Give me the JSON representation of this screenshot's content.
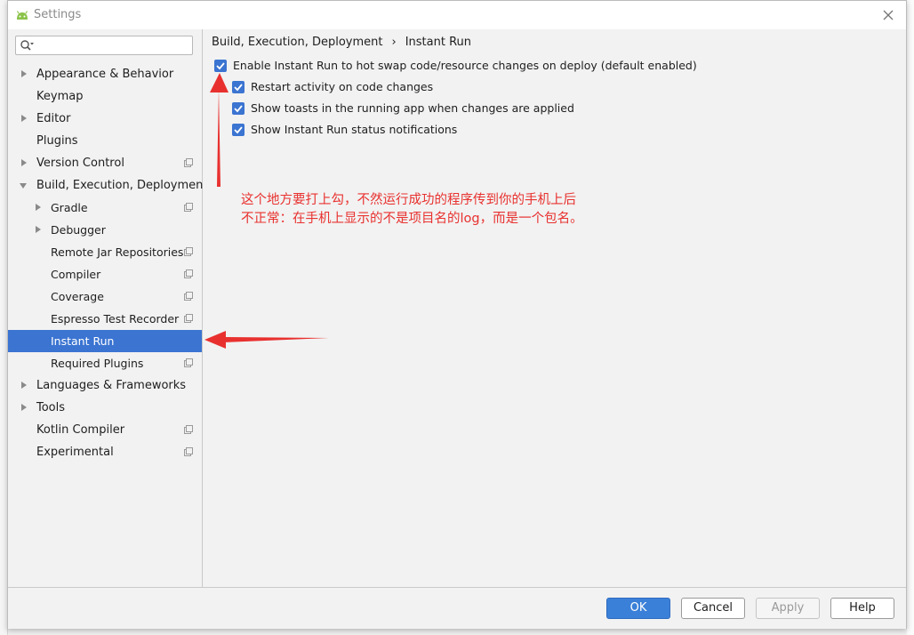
{
  "window": {
    "title": "Settings"
  },
  "search": {
    "placeholder": ""
  },
  "sidebar": {
    "items": [
      {
        "label": "Appearance & Behavior",
        "level": 0,
        "arrow": "collapsed",
        "proj": false
      },
      {
        "label": "Keymap",
        "level": 0,
        "arrow": "none",
        "proj": false
      },
      {
        "label": "Editor",
        "level": 0,
        "arrow": "collapsed",
        "proj": false
      },
      {
        "label": "Plugins",
        "level": 0,
        "arrow": "none",
        "proj": false
      },
      {
        "label": "Version Control",
        "level": 0,
        "arrow": "collapsed",
        "proj": true
      },
      {
        "label": "Build, Execution, Deployment",
        "level": 0,
        "arrow": "expanded",
        "proj": false
      },
      {
        "label": "Gradle",
        "level": 1,
        "arrow": "collapsed",
        "proj": true
      },
      {
        "label": "Debugger",
        "level": 1,
        "arrow": "collapsed",
        "proj": false
      },
      {
        "label": "Remote Jar Repositories",
        "level": 1,
        "arrow": "none",
        "proj": true
      },
      {
        "label": "Compiler",
        "level": 1,
        "arrow": "none",
        "proj": true
      },
      {
        "label": "Coverage",
        "level": 1,
        "arrow": "none",
        "proj": true
      },
      {
        "label": "Espresso Test Recorder",
        "level": 1,
        "arrow": "none",
        "proj": true
      },
      {
        "label": "Instant Run",
        "level": 1,
        "arrow": "none",
        "proj": false,
        "selected": true
      },
      {
        "label": "Required Plugins",
        "level": 1,
        "arrow": "none",
        "proj": true
      },
      {
        "label": "Languages & Frameworks",
        "level": 0,
        "arrow": "collapsed",
        "proj": false
      },
      {
        "label": "Tools",
        "level": 0,
        "arrow": "collapsed",
        "proj": false
      },
      {
        "label": "Kotlin Compiler",
        "level": 0,
        "arrow": "none",
        "proj": true
      },
      {
        "label": "Experimental",
        "level": 0,
        "arrow": "none",
        "proj": true
      }
    ]
  },
  "breadcrumb": {
    "parent": "Build, Execution, Deployment",
    "separator": "›",
    "current": "Instant Run"
  },
  "options": {
    "enable": {
      "label": "Enable Instant Run to hot swap code/resource changes on deploy (default enabled)",
      "checked": true
    },
    "restart": {
      "label": "Restart activity on code changes",
      "checked": true
    },
    "toasts": {
      "label": "Show toasts in the running app when changes are applied",
      "checked": true
    },
    "notifications": {
      "label": "Show Instant Run status notifications",
      "checked": true
    }
  },
  "annotation": {
    "line1": "这个地方要打上勾，不然运行成功的程序传到你的手机上后",
    "line2": "不正常：在手机上显示的不是项目名的log，而是一个包名。",
    "color": "#e8312f"
  },
  "footer": {
    "ok": "OK",
    "cancel": "Cancel",
    "apply": "Apply",
    "help": "Help"
  },
  "colors": {
    "accent": "#3b74d1",
    "primary_button": "#3b80d8"
  }
}
